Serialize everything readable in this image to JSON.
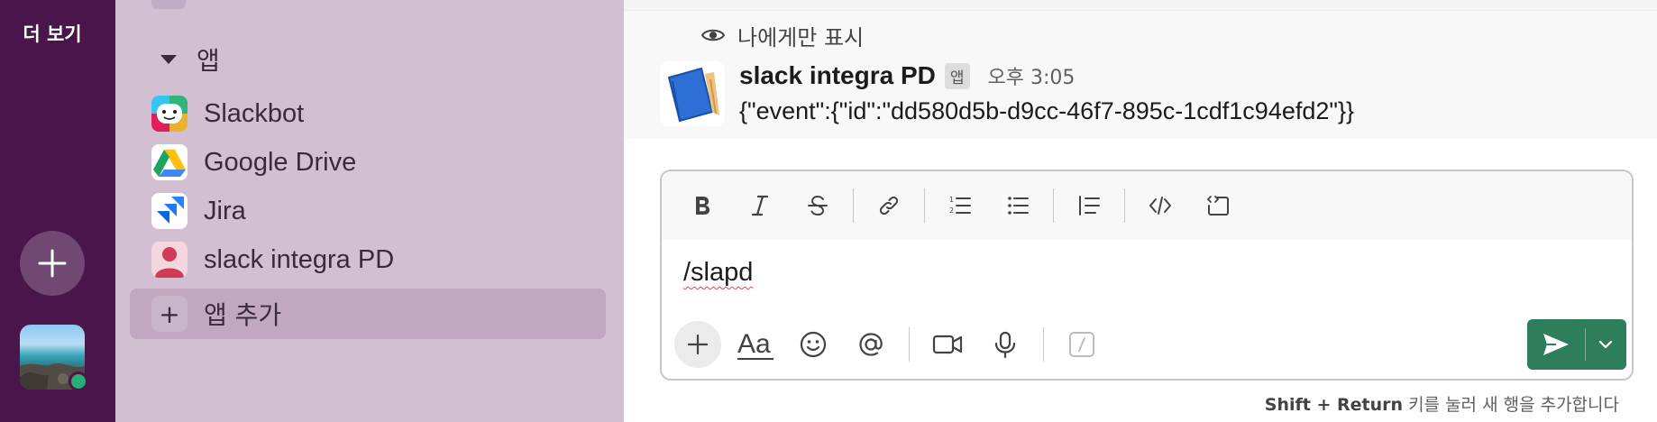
{
  "rail": {
    "more_label": "더 보기"
  },
  "sidebar": {
    "section_label": "앱",
    "items": [
      {
        "label": "Slackbot"
      },
      {
        "label": "Google Drive"
      },
      {
        "label": "Jira"
      },
      {
        "label": "slack integra PD"
      }
    ],
    "add_app_label": "앱 추가"
  },
  "message": {
    "visibility": "나에게만 표시",
    "sender": "slack integra PD",
    "badge": "앱",
    "time": "오후 3:05",
    "body": "{\"event\":{\"id\":\"dd580d5b-d9cc-46f7-895c-1cdf1c94efd2\"}}"
  },
  "composer": {
    "input_value": "/slapd",
    "hint_key": "Shift + Return",
    "hint_text": " 키를 눌러 새 행을 추가합니다"
  },
  "toolbar_icons": [
    "bold-icon",
    "italic-icon",
    "strikethrough-icon",
    "link-icon",
    "ordered-list-icon",
    "bullet-list-icon",
    "blockquote-icon",
    "code-icon",
    "code-block-icon"
  ],
  "bottom_icons": [
    "plus-icon",
    "formatting-icon",
    "emoji-icon",
    "mention-icon",
    "video-icon",
    "microphone-icon",
    "slash-command-icon"
  ],
  "colors": {
    "rail_bg": "#4a154b",
    "sidebar_bg": "#d2bfd2",
    "send_bg": "#2e7d5b",
    "status_online": "#2bac76"
  }
}
